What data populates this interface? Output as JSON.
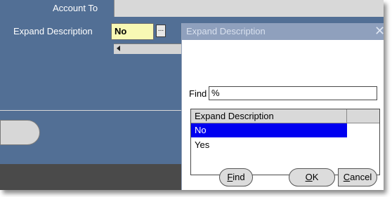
{
  "form": {
    "account_to_label": "Account To",
    "expand_description_label": "Expand Description",
    "expand_description_value": "No",
    "lov_button_label": "..."
  },
  "dialog": {
    "title": "Expand Description",
    "close_glyph": "✕",
    "find_label": "Find",
    "find_value": "%",
    "list_header": "Expand Description",
    "list_items": [
      "No",
      "Yes"
    ],
    "selected_index": 0,
    "buttons": {
      "find": {
        "mnemonic": "F",
        "rest": "ind"
      },
      "ok": {
        "mnemonic": "O",
        "rest": "K"
      },
      "cancel": {
        "mnemonic": "C",
        "rest": "ancel"
      }
    }
  },
  "colors": {
    "background": "#526f95",
    "selected_row": "#0000f0",
    "field_yellow": "#f8f8b4",
    "dialog_titlebar": "#8fa0bd"
  },
  "icons": {
    "close": "close-icon",
    "scroll_left": "scroll-left-arrow-icon"
  }
}
